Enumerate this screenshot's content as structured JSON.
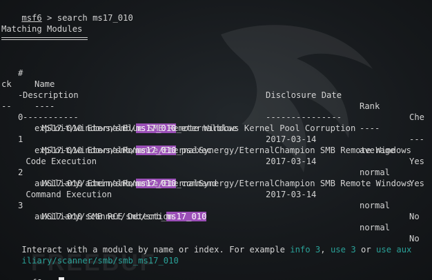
{
  "colors": {
    "background": "#16191c",
    "text": "#d3d3d3",
    "highlight": "#9b4fb7",
    "hint": "#2aa198"
  },
  "top_prompt": {
    "label": "msf6",
    "sep": " > ",
    "command": "search ms17_010"
  },
  "heading": "Matching Modules",
  "table": {
    "h_num": "#",
    "h_name": "Name",
    "h_date": "Disclosure Date",
    "h_rank": "Rank",
    "h_check_trunc": "Che",
    "h_check_wrap": "ck",
    "h_desc": "Description",
    "dash_num": "-",
    "dash_name": "----",
    "dash_date": "---------------",
    "dash_rank": "----",
    "dash_check": "---",
    "dash_check_wrap": "--",
    "dash_desc": "-----------",
    "rows": [
      {
        "num": "0",
        "name_pre": "exploit/windows/smb/",
        "name_match": "ms17_010",
        "name_post": "_eternalblue",
        "date": "2017-03-14",
        "rank": "average",
        "check": "Yes",
        "desc": "MS17-010 EternalBlue SMB Remote Windows Kernel Pool Corruption",
        "desc_wrap": ""
      },
      {
        "num": "1",
        "name_pre": "exploit/windows/smb/",
        "name_match": "ms17_010",
        "name_post": "_psexec",
        "date": "2017-03-14",
        "rank": "normal",
        "check": "Yes",
        "desc": "MS17-010 EternalRomance/EternalSynergy/EternalChampion SMB Remote Windows",
        "desc_wrap": "Code Execution"
      },
      {
        "num": "2",
        "name_pre": "auxiliary/admin/smb/",
        "name_match": "ms17_010",
        "name_post": "_command",
        "date": "2017-03-14",
        "rank": "normal",
        "check": "No",
        "desc": "MS17-010 EternalRomance/EternalSynergy/EternalChampion SMB Remote Windows",
        "desc_wrap": "Command Execution"
      },
      {
        "num": "3",
        "name_pre": "auxiliary/scanner/smb/smb_",
        "name_match": "ms17_010",
        "name_post": "",
        "date": "",
        "rank": "normal",
        "check": "No",
        "desc": "MS17-010 SMB RCE Detection",
        "desc_wrap": ""
      }
    ]
  },
  "hint": {
    "text1": "Interact with a module by name or index. For example ",
    "info_cmd": "info 3",
    "sep1": ", ",
    "use_cmd": "use 3",
    "sep2": " or ",
    "use_aux_start": "use aux",
    "use_aux_end": "iliary/scanner/smb/smb_ms17_010"
  },
  "bottom_prompt": {
    "label": "msf6",
    "sep": " > "
  },
  "watermark": "FREEBUF"
}
